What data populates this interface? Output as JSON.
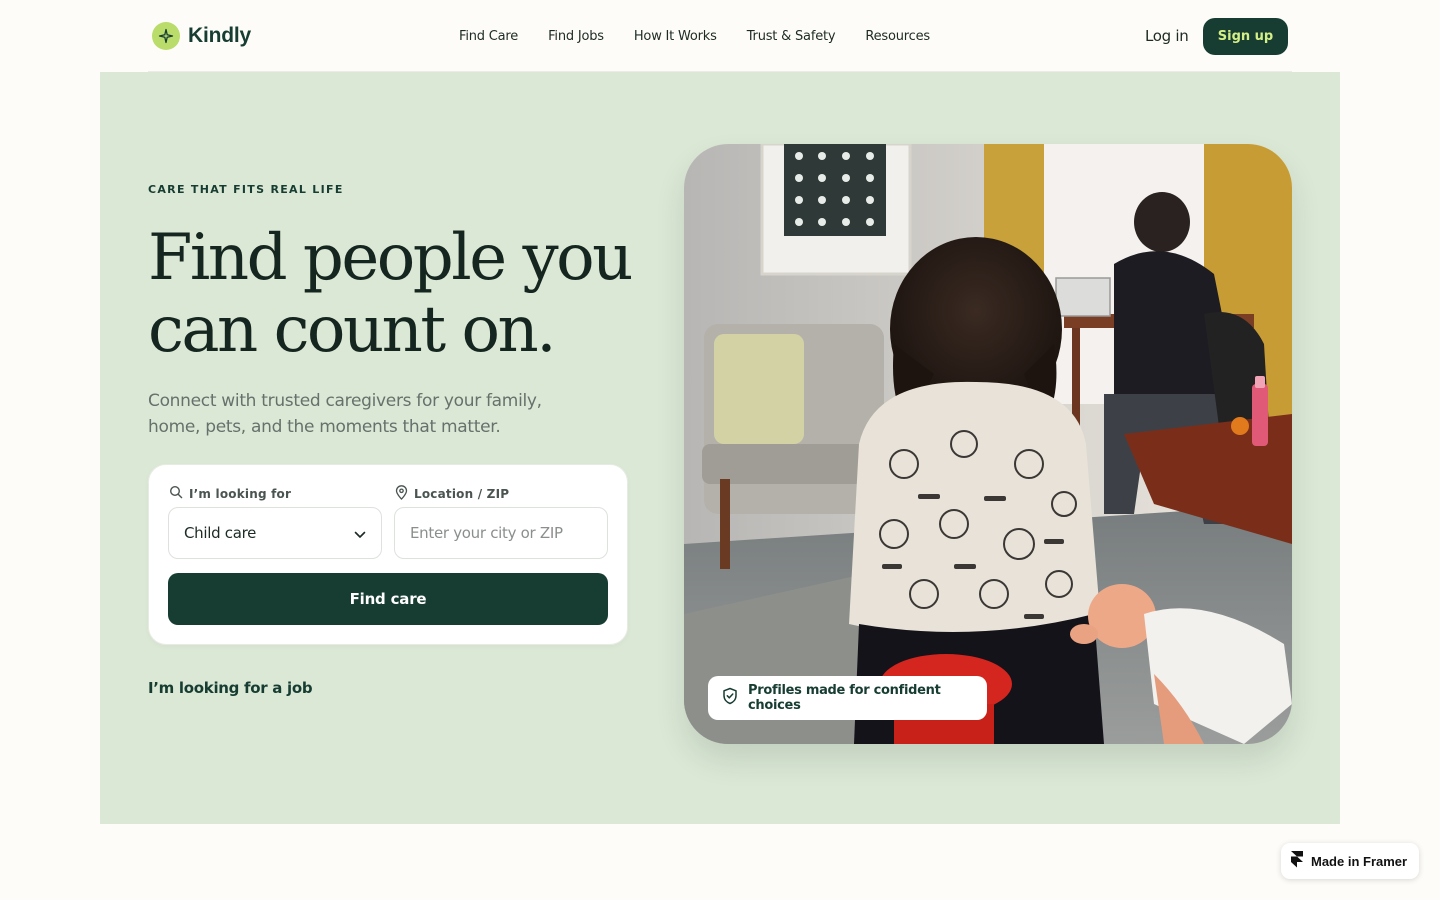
{
  "brand": {
    "name": "Kindly",
    "accent": "#b9dc6a",
    "primary": "#173d33"
  },
  "nav": {
    "items": [
      {
        "label": "Find Care"
      },
      {
        "label": "Find Jobs"
      },
      {
        "label": "How It Works"
      },
      {
        "label": "Trust & Safety"
      },
      {
        "label": "Resources"
      }
    ],
    "login_label": "Log in",
    "signup_label": "Sign up"
  },
  "hero": {
    "eyebrow": "CARE THAT FITS REAL LIFE",
    "headline": "Find people you can count on.",
    "subtext": "Connect with trusted caregivers for your family, home, pets, and the moments that matter.",
    "background": "#dce8d6"
  },
  "search": {
    "looking_for_label": "I’m looking for",
    "looking_for_value": "Child care",
    "location_label": "Location / ZIP",
    "location_placeholder": "Enter your city or ZIP",
    "location_value": "",
    "submit_label": "Find care",
    "icons": {
      "looking_for": "search-icon",
      "location": "map-pin-icon",
      "select": "chevron-down-icon"
    }
  },
  "job_link": "I’m looking for a job",
  "photo": {
    "badge_text": "Profiles made for confident choices",
    "badge_icon": "shield-check-icon"
  },
  "framer_badge": {
    "label": "Made in Framer",
    "icon": "framer-icon"
  }
}
